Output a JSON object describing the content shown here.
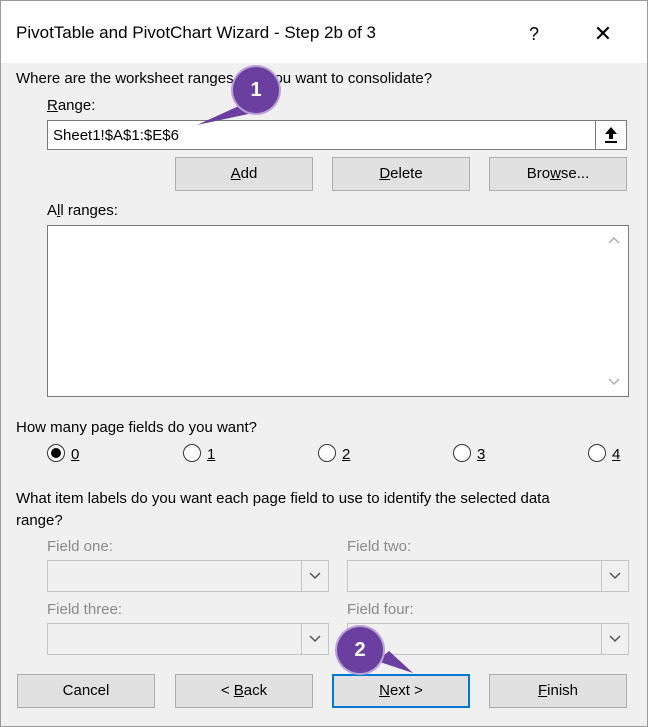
{
  "window": {
    "title": "PivotTable and PivotChart Wizard - Step 2b of 3",
    "help_glyph": "?",
    "close_glyph": "✕"
  },
  "consolidate": {
    "question": "Where are the worksheet ranges that you want to consolidate?",
    "range_label_first": "R",
    "range_label_rest": "ange:",
    "range_value": "Sheet1!$A$1:$E$6"
  },
  "range_buttons": {
    "add_u": "A",
    "add_rest": "dd",
    "delete_u": "D",
    "delete_rest": "elete",
    "browse_pre": "Bro",
    "browse_u": "w",
    "browse_rest": "se..."
  },
  "all_ranges": {
    "label_pre": "A",
    "label_u": "l",
    "label_rest": "l ranges:"
  },
  "page_fields": {
    "question": "How many page fields do you want?",
    "options": [
      "0",
      "1",
      "2",
      "3",
      "4"
    ],
    "selected": "0"
  },
  "item_labels": {
    "question_line1": "What item labels do you want each page field to use to identify the selected data",
    "question_line2": "range?",
    "field_one": "Field one:",
    "field_two": "Field two:",
    "field_three": "Field three:",
    "field_four": "Field four:"
  },
  "footer": {
    "cancel": "Cancel",
    "back_pre": "< ",
    "back_u": "B",
    "back_rest": "ack",
    "next_u": "N",
    "next_rest": "ext >",
    "finish_u": "F",
    "finish_rest": "inish"
  },
  "callouts": {
    "one": "1",
    "two": "2"
  },
  "colors": {
    "callout": "#6b3fa0",
    "focus": "#0078d7",
    "dialog_bg": "#f0f0f0"
  }
}
